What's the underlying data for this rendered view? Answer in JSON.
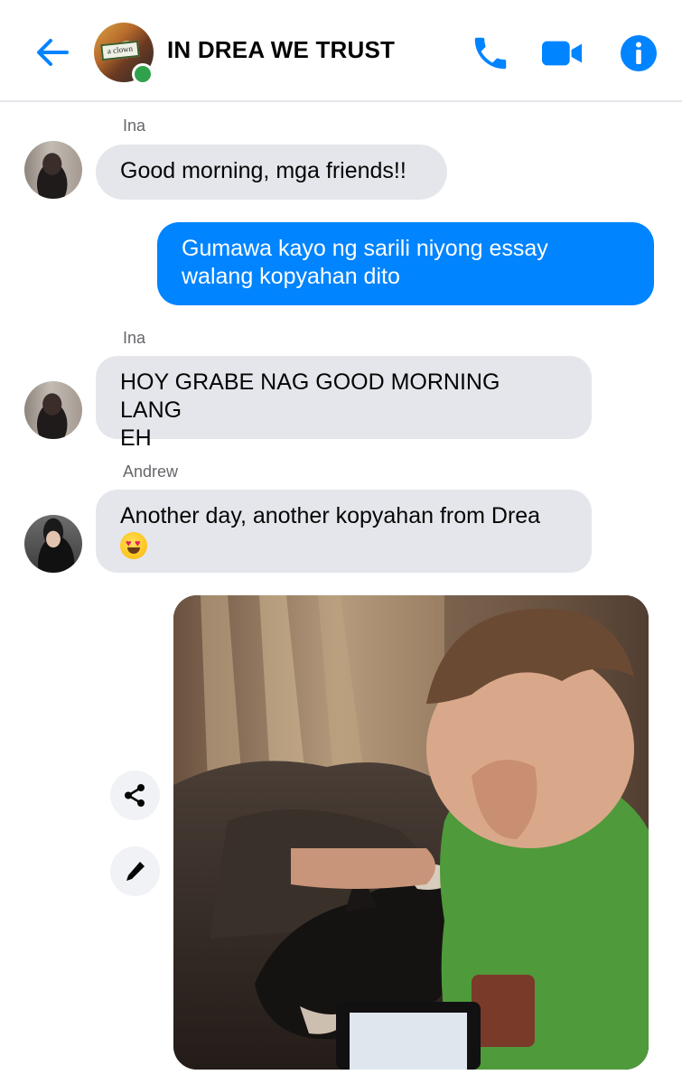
{
  "header": {
    "title": "IN DREA WE TRUST",
    "avatar_sign": "a clown",
    "icons": [
      "back-arrow-icon",
      "phone-icon",
      "video-camera-icon",
      "info-icon"
    ],
    "accent_color": "#0084ff",
    "online_color": "#31a24c"
  },
  "messages": [
    {
      "sender": "Ina",
      "text": "Good morning, mga friends!!",
      "direction": "incoming"
    },
    {
      "text_lines": [
        "Gumawa kayo ng sarili niyong essay",
        "walang kopyahan dito"
      ],
      "direction": "outgoing"
    },
    {
      "sender": "Ina",
      "text_lines": [
        "HOY GRABE NAG GOOD MORNING LANG",
        "EH"
      ],
      "direction": "incoming"
    },
    {
      "sender": "Andrew",
      "text": "Another day, another kopyahan from Drea",
      "emoji": "heart-eyes-emoji",
      "direction": "incoming"
    }
  ],
  "photo_message": {
    "actions": [
      "share-icon",
      "edit-pencil-icon"
    ]
  }
}
